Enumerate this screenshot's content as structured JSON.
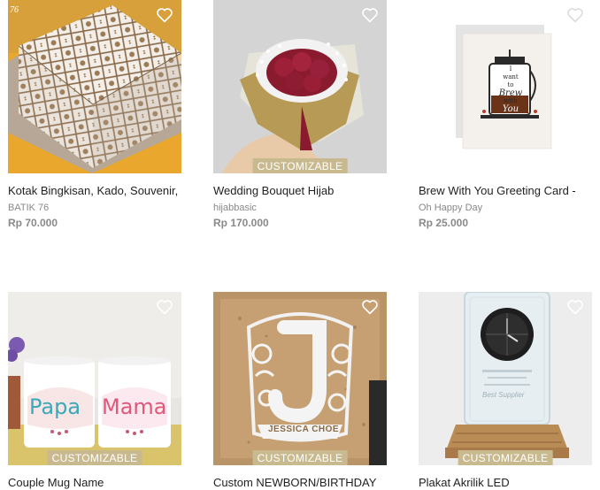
{
  "products": [
    {
      "title": "Kotak Bingkisan, Kado, Souvenir,",
      "shop": "BATIK 76",
      "price": "Rp 70.000",
      "badge": "",
      "image_corner_text": "76",
      "icon": "heart-icon"
    },
    {
      "title": "Wedding Bouquet Hijab",
      "shop": "hijabbasic",
      "price": "Rp 170.000",
      "badge": "CUSTOMIZABLE",
      "icon": "heart-icon"
    },
    {
      "title": "Brew With You Greeting Card -",
      "shop": "Oh Happy Day",
      "price": "Rp 25.000",
      "badge": "",
      "card_text": [
        "I",
        "want",
        "to",
        "Brew",
        "with",
        "You"
      ],
      "icon": "heart-icon"
    },
    {
      "title": "Couple Mug Name",
      "shop": "",
      "price": "",
      "badge": "CUSTOMIZABLE",
      "mug_text": [
        "Papa",
        "Mama"
      ],
      "icon": "heart-icon"
    },
    {
      "title": "Custom NEWBORN/BIRTHDAY",
      "shop": "",
      "price": "",
      "badge": "CUSTOMIZABLE",
      "frame_text": [
        "J",
        "JESSICA CHOE"
      ],
      "icon": "heart-icon"
    },
    {
      "title": "Plakat Akrilik LED",
      "shop": "",
      "price": "",
      "badge": "CUSTOMIZABLE",
      "plaque_text": [
        "Best Supplier"
      ],
      "icon": "heart-icon"
    }
  ],
  "colors": {
    "badge": "#c9b98e",
    "price": "#8a8a8a",
    "shop": "#888888"
  }
}
